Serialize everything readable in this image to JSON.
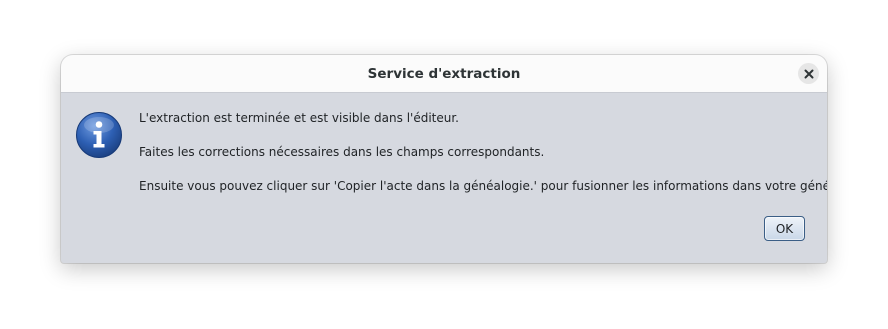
{
  "dialog": {
    "title": "Service d'extraction",
    "icon": "info-icon",
    "messages": [
      "L'extraction est terminée et est visible dans l'éditeur.",
      "Faites les corrections nécessaires dans les champs correspondants.",
      "Ensuite vous pouvez cliquer sur 'Copier l'acte dans la généalogie.' pour fusionner les informations dans votre généalogie."
    ],
    "ok_label": "OK",
    "close_icon": "close-icon"
  },
  "colors": {
    "titlebar_bg": "#fbfbfb",
    "body_bg": "#d6d9e0",
    "info_icon_blue": "#2d5fb3",
    "ok_border": "#3b5e86"
  }
}
